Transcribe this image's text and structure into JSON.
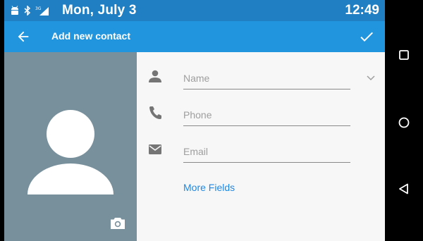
{
  "status_bar": {
    "date": "Mon, July 3",
    "time": "12:49",
    "icons": [
      "android-icon",
      "bluetooth-icon",
      "3g-signal-icon"
    ],
    "network_label": "3G"
  },
  "app_bar": {
    "title": "Add new contact",
    "back_icon": "arrow-back-icon",
    "save_icon": "check-icon"
  },
  "photo": {
    "avatar_icon": "person-avatar-icon",
    "camera_icon": "camera-icon"
  },
  "form": {
    "fields": [
      {
        "icon": "person-icon",
        "placeholder": "Name",
        "value": ""
      },
      {
        "icon": "phone-icon",
        "placeholder": "Phone",
        "value": ""
      },
      {
        "icon": "email-icon",
        "placeholder": "Email",
        "value": ""
      }
    ],
    "more_fields_label": "More Fields"
  },
  "nav_bar": {
    "buttons": [
      "recents-square-icon",
      "home-circle-icon",
      "back-triangle-icon"
    ]
  },
  "colors": {
    "status_bar": "#1f7fc2",
    "app_bar": "#2195de",
    "photo_bg": "#78909c",
    "form_bg": "#f7f7f7",
    "link": "#1e88e5"
  }
}
